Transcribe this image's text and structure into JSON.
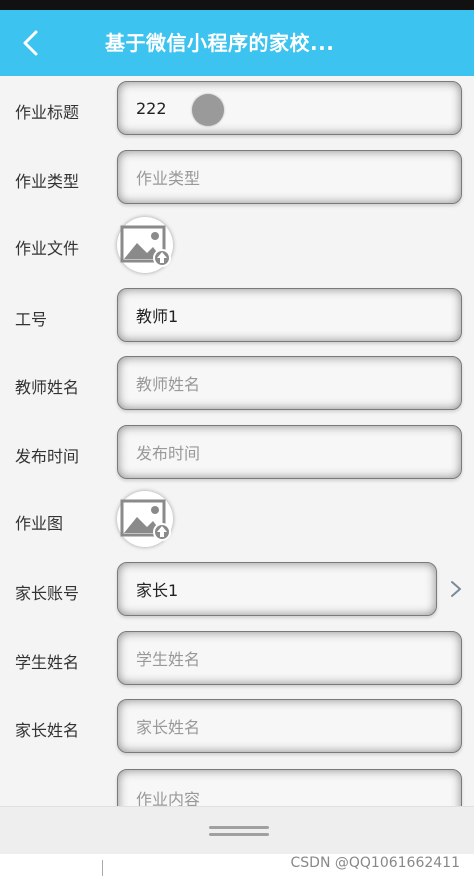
{
  "header": {
    "title": "基于微信小程序的家校..."
  },
  "form": {
    "homework_title": {
      "label": "作业标题",
      "value": "222"
    },
    "homework_type": {
      "label": "作业类型",
      "placeholder": "作业类型"
    },
    "homework_file": {
      "label": "作业文件"
    },
    "staff_id": {
      "label": "工号",
      "value": "教师1"
    },
    "teacher_name": {
      "label": "教师姓名",
      "placeholder": "教师姓名"
    },
    "publish_time": {
      "label": "发布时间",
      "placeholder": "发布时间"
    },
    "homework_image": {
      "label": "作业图"
    },
    "parent_account": {
      "label": "家长账号",
      "value": "家长1"
    },
    "student_name": {
      "label": "学生姓名",
      "placeholder": "学生姓名"
    },
    "parent_name": {
      "label": "家长姓名",
      "placeholder": "家长姓名"
    },
    "homework_content": {
      "placeholder": "作业内容"
    }
  },
  "footer": {
    "watermark": "CSDN @QQ1061662411"
  },
  "colors": {
    "nav_background": "#3cc3f0",
    "nav_text": "#ffffff"
  }
}
